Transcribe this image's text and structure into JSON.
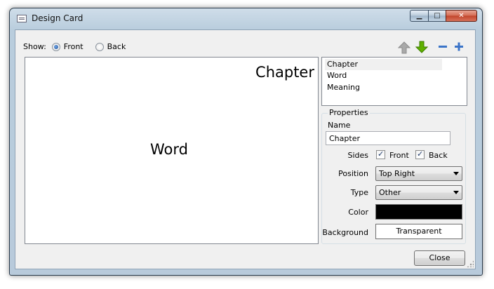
{
  "window": {
    "title": "Design Card",
    "min_label": "▁",
    "max_label": "□",
    "close_label": "✕"
  },
  "show": {
    "label": "Show:",
    "front": "Front",
    "back": "Back",
    "selected": "Front"
  },
  "toolbar": {
    "move_up": "up-arrow-icon",
    "move_down": "down-arrow-icon",
    "remove": "minus-icon",
    "add": "plus-icon"
  },
  "canvas": {
    "chapter_text": "Chapter",
    "word_text": "Word"
  },
  "fields": {
    "items": [
      "Chapter",
      "Word",
      "Meaning"
    ],
    "selected": "Chapter"
  },
  "properties": {
    "legend": "Properties",
    "name_label": "Name",
    "name_value": "Chapter",
    "sides_label": "Sides",
    "sides_front": "Front",
    "sides_back": "Back",
    "position_label": "Position",
    "position_value": "Top Right",
    "type_label": "Type",
    "type_value": "Other",
    "color_label": "Color",
    "color_value": "#000000",
    "background_label": "Background",
    "background_value": "Transparent"
  },
  "footer": {
    "close_label": "Close"
  },
  "colors": {
    "arrow_up": "#a9a9a9",
    "arrow_down": "#5fb000",
    "plus_minus": "#3b74c8"
  }
}
